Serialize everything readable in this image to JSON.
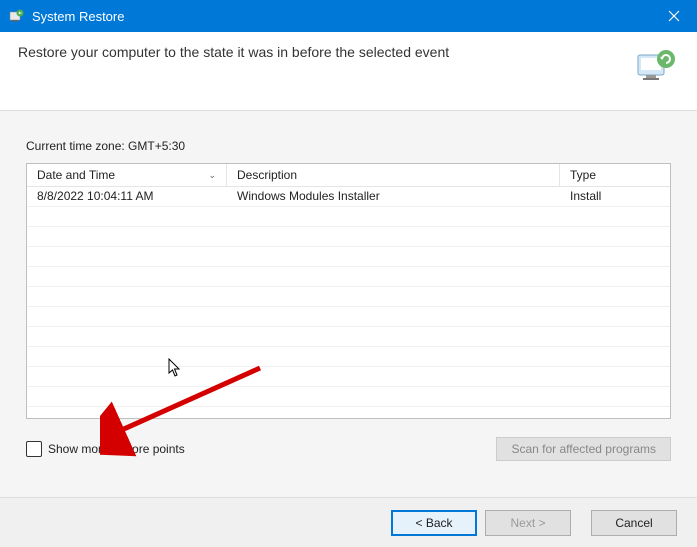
{
  "titlebar": {
    "title": "System Restore"
  },
  "header": {
    "text": "Restore your computer to the state it was in before the selected event"
  },
  "content": {
    "timezone_label": "Current time zone: GMT+5:30",
    "columns": {
      "date": "Date and Time",
      "description": "Description",
      "type": "Type"
    },
    "rows": [
      {
        "date": "8/8/2022 10:04:11 AM",
        "description": "Windows Modules Installer",
        "type": "Install"
      }
    ],
    "checkbox_label": "Show more restore points",
    "scan_button": "Scan for affected programs"
  },
  "buttons": {
    "back": "< Back",
    "next": "Next >",
    "cancel": "Cancel"
  }
}
